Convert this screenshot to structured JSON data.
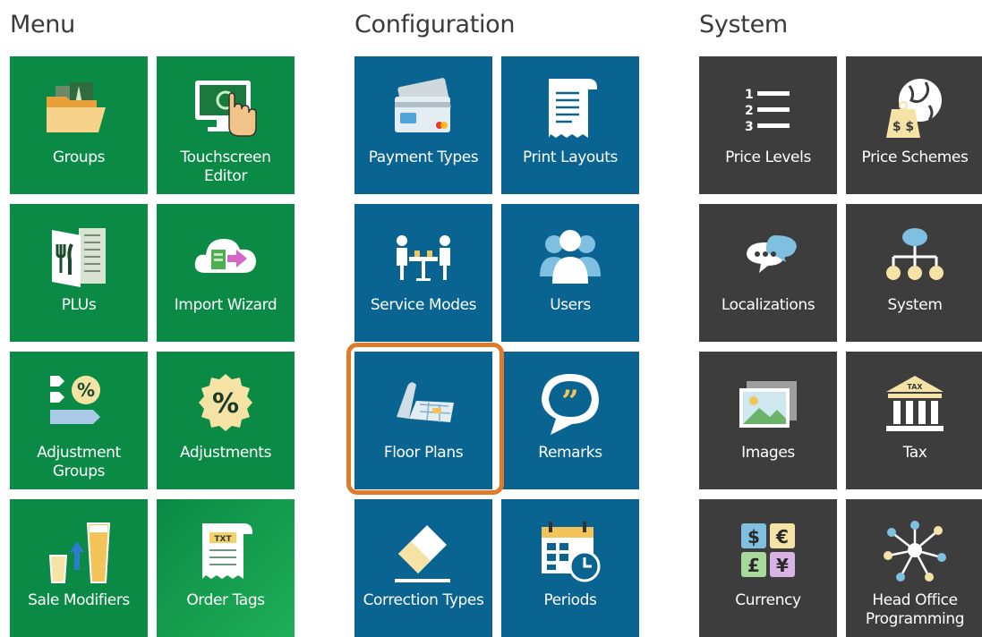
{
  "sections": {
    "menu": {
      "title": "Menu",
      "color": "#0a8a45",
      "tiles": [
        {
          "label": "Groups",
          "icon": "folder-icon"
        },
        {
          "label": "Touchscreen\nEditor",
          "icon": "touchscreen-icon"
        },
        {
          "label": "PLUs",
          "icon": "menu-book-icon"
        },
        {
          "label": "Import Wizard",
          "icon": "cloud-import-icon"
        },
        {
          "label": "Adjustment\nGroups",
          "icon": "tags-percent-icon"
        },
        {
          "label": "Adjustments",
          "icon": "percent-badge-icon"
        },
        {
          "label": "Sale Modifiers",
          "icon": "glasses-icon"
        },
        {
          "label": "Order Tags",
          "icon": "receipt-txt-icon"
        }
      ]
    },
    "configuration": {
      "title": "Configuration",
      "color": "#0a6491",
      "tiles": [
        {
          "label": "Payment Types",
          "icon": "credit-card-icon"
        },
        {
          "label": "Print Layouts",
          "icon": "receipt-icon"
        },
        {
          "label": "Service Modes",
          "icon": "dining-table-icon"
        },
        {
          "label": "Users",
          "icon": "users-icon"
        },
        {
          "label": "Floor Plans",
          "icon": "floor-plan-icon"
        },
        {
          "label": "Remarks",
          "icon": "speech-bubble-icon"
        },
        {
          "label": "Correction Types",
          "icon": "eraser-icon"
        },
        {
          "label": "Periods",
          "icon": "calendar-clock-icon"
        }
      ]
    },
    "system": {
      "title": "System",
      "color": "#3d3d3d",
      "tiles": [
        {
          "label": "Price Levels",
          "icon": "numbered-list-icon"
        },
        {
          "label": "Price Schemes",
          "icon": "globe-price-icon"
        },
        {
          "label": "Localizations",
          "icon": "chat-bubbles-icon"
        },
        {
          "label": "System",
          "icon": "org-chart-icon"
        },
        {
          "label": "Images",
          "icon": "images-icon"
        },
        {
          "label": "Tax",
          "icon": "tax-building-icon"
        },
        {
          "label": "Currency",
          "icon": "currency-icon"
        },
        {
          "label": "Head Office\nProgramming",
          "icon": "network-icon"
        }
      ]
    }
  },
  "selected": "Floor Plans",
  "highlight_color": "#e07b2c",
  "icon_text": {
    "price_levels_numbers": [
      "1",
      "2",
      "3"
    ],
    "price_schemes_tag": "$ $",
    "tax_sign": "TAX",
    "currency_symbols": [
      "$",
      "€",
      "£",
      "¥"
    ],
    "order_tags_txt": "TXT"
  }
}
